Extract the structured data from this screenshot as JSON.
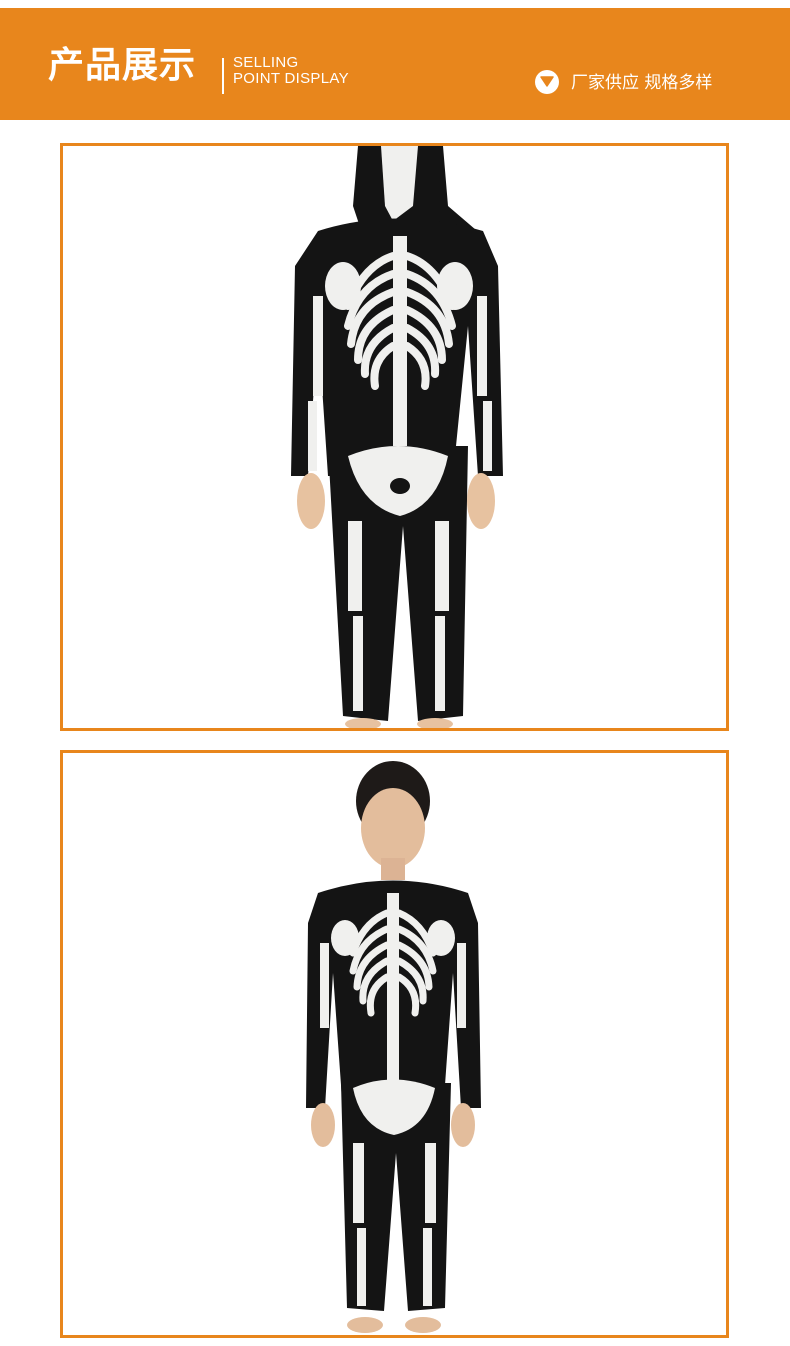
{
  "header": {
    "title_cn": "产品展示",
    "title_en_line1": "SELLING",
    "title_en_line2": "POINT DISPLAY",
    "tagline": "厂家供应 规格多样",
    "badge_icon": "chevron-down-icon"
  },
  "colors": {
    "accent": "#e8861c",
    "costume_black": "#141414",
    "bone_white": "#f2f2f0"
  },
  "gallery": {
    "photos": [
      {
        "subject": "skeleton-costume-hood-up"
      },
      {
        "subject": "skeleton-costume-worn-by-model"
      }
    ]
  }
}
